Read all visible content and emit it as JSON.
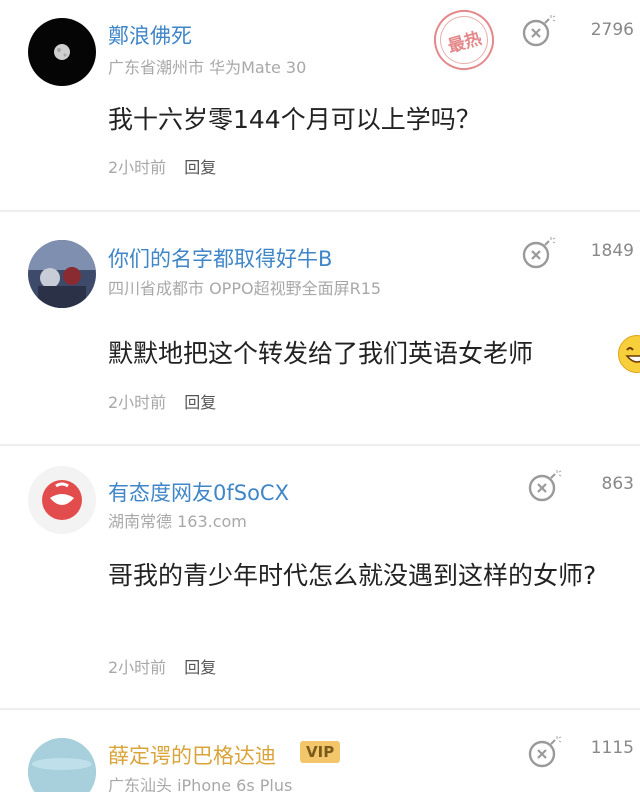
{
  "comments": [
    {
      "username": "鄭浪佛死",
      "meta": "广东省潮州市  华为Mate 30",
      "likes": "2796",
      "content": "我十六岁零144个月可以上学吗？",
      "time": "2小时前",
      "reply": "回复",
      "badge": "最热"
    },
    {
      "username": "你们的名字都取得好牛B",
      "meta": "四川省成都市  OPPO超视野全面屏R15",
      "likes": "1849",
      "content": "默默地把这个转发给了我们英语女老师",
      "time": "2小时前",
      "reply": "回复"
    },
    {
      "username": "有态度网友0fSoCX",
      "meta": "湖南常德  163.com",
      "likes": "863",
      "content": "哥我的青少年时代怎么就没遇到这样的女师?",
      "time": "2小时前",
      "reply": "回复"
    },
    {
      "username": "薛定谔的巴格达迪",
      "vip": "VIP",
      "meta": "广东汕头  iPhone 6s Plus",
      "likes": "1115"
    }
  ],
  "colors": {
    "username": "#3f86c8",
    "vip_username": "#d9a43a",
    "hot_stamp": "#e4898b"
  },
  "icons": {
    "like": "bomb-like-icon",
    "emoji": "smiling-emoji-icon"
  }
}
